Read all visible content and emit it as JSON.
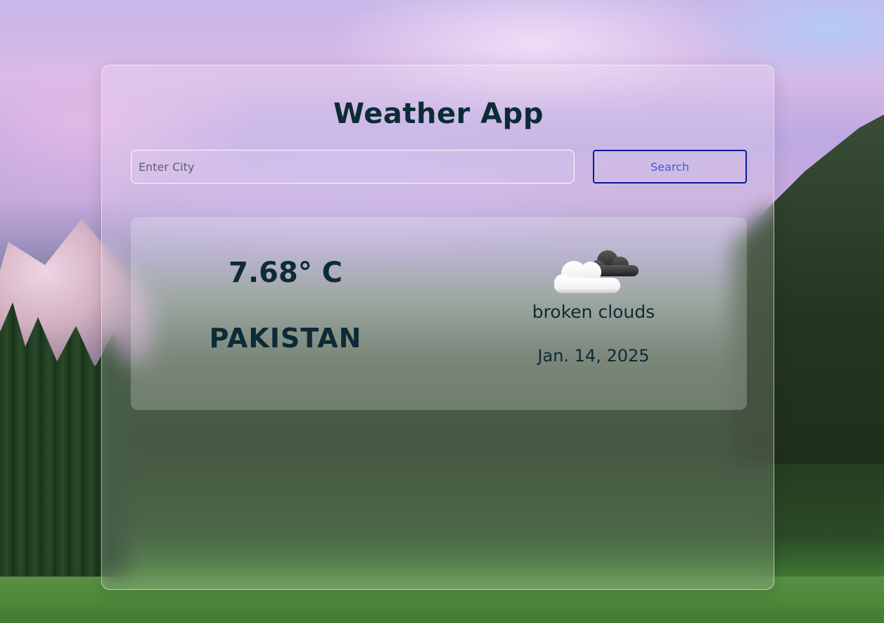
{
  "app": {
    "title": "Weather App"
  },
  "search": {
    "placeholder": "Enter City",
    "value": "",
    "button_label": "Search"
  },
  "weather": {
    "temperature": "7.68° C",
    "location": "PAKISTAN",
    "description": "broken clouds",
    "date": "Jan. 14, 2025",
    "icon": "broken-clouds-icon"
  },
  "colors": {
    "text_primary": "#0d2b36",
    "button_border": "#0b1a9a",
    "button_text": "#3f5fd6"
  }
}
